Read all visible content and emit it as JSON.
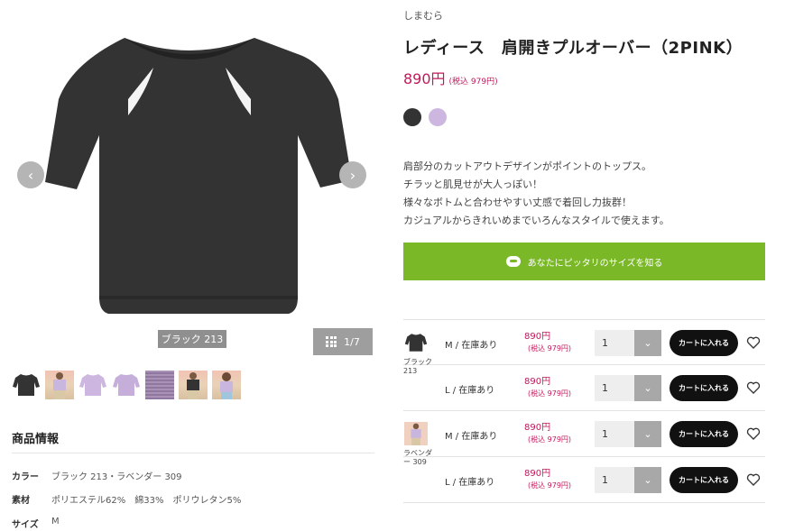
{
  "gallery": {
    "color_caption": "ブラック 213",
    "counter": "1/7",
    "prev_icon": "chevron-left-icon",
    "next_icon": "chevron-right-icon",
    "thumbnails": [
      "black-top",
      "model-photo",
      "lavender-top",
      "lavender-top-back",
      "lavender-knit-detail",
      "model-photo-2",
      "model-photo-3"
    ]
  },
  "info": {
    "title": "商品情報",
    "rows": [
      {
        "key": "カラー",
        "value": "ブラック 213・ラベンダー 309"
      },
      {
        "key": "素材",
        "value": "ポリエステル62%　綿33%　ポリウレタン5%"
      },
      {
        "key": "サイズ",
        "value": "M"
      }
    ]
  },
  "product": {
    "brand": "しまむら",
    "title": "レディース　肩開きプルオーバー（2PINK）",
    "price": "890円",
    "price_tax": "(税込 979円)",
    "swatch_colors": [
      "#333333",
      "#cdb7e0"
    ],
    "description": [
      "肩部分のカットアウトデザインがポイントのトップス。",
      "チラッと肌見せが大人っぽい！",
      "様々なボトムと合わせやすい丈感で着回し力抜群！",
      "カジュアルからきれいめまでいろんなスタイルで使えます。"
    ],
    "fit_button": "あなたにピッタリのサイズを知る"
  },
  "stock": {
    "cart_label": "カートに入れる",
    "rows": [
      {
        "color": "ブラック 213",
        "size": "M / 在庫あり",
        "price": "890円",
        "tax": "(税込 979円)",
        "qty": "1"
      },
      {
        "color": "",
        "size": "L / 在庫あり",
        "price": "890円",
        "tax": "(税込 979円)",
        "qty": "1"
      },
      {
        "color": "ラベンダー 309",
        "size": "M / 在庫あり",
        "price": "890円",
        "tax": "(税込 979円)",
        "qty": "1"
      },
      {
        "color": "",
        "size": "L / 在庫あり",
        "price": "890円",
        "tax": "(税込 979円)",
        "qty": "1"
      }
    ]
  },
  "colors": {
    "accent_green": "#7ab827",
    "price_pink": "#c2185b"
  }
}
